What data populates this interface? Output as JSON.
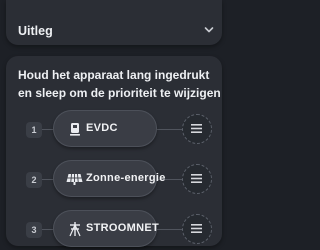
{
  "accordion": {
    "title": "Uitleg",
    "icon": "chevron-down-icon"
  },
  "instruction": "Houd het apparaat lang ingedrukt en sleep om de prioriteit te wijzigen",
  "priority_items": [
    {
      "number": "1",
      "label": "EVDC",
      "icon": "ev-charger-icon"
    },
    {
      "number": "2",
      "label": "Zonne-energie",
      "icon": "solar-panel-icon"
    },
    {
      "number": "3",
      "label": "STROOMNET",
      "icon": "power-grid-icon"
    }
  ],
  "drag_handle_icon": "drag-handle-icon"
}
